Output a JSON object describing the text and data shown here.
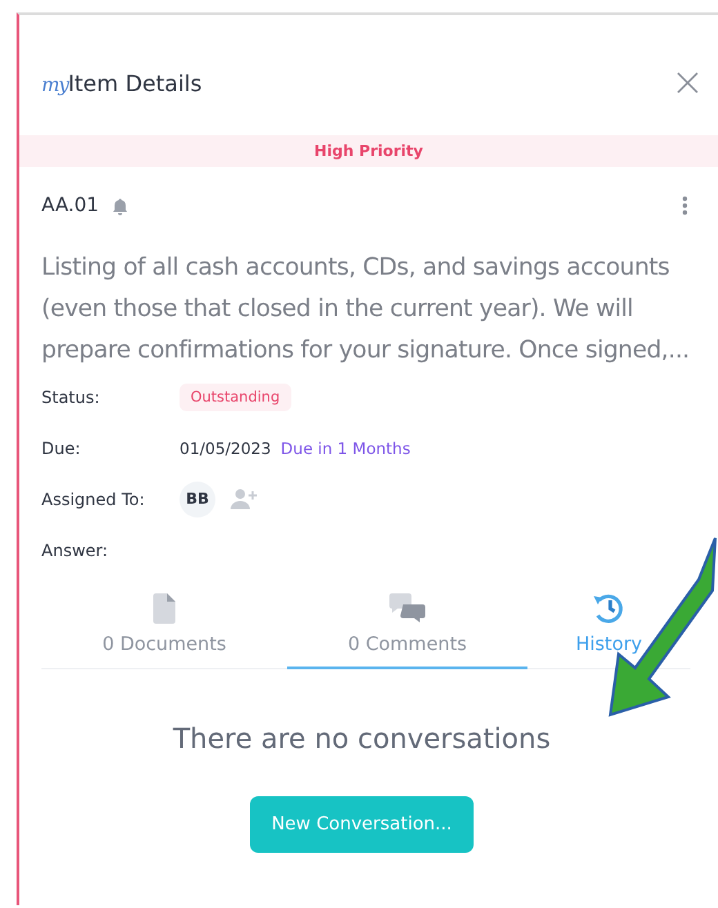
{
  "window": {
    "title_prefix": "my",
    "title": "Item Details"
  },
  "priority_banner": "High Priority",
  "item": {
    "code": "AA.01",
    "description": "Listing of all cash accounts, CDs, and savings accounts (even those that closed in the current year). We will prepare confirmations for your signature. Once signed,..."
  },
  "fields": [
    {
      "kind": "status",
      "label": "Status:",
      "value": "Outstanding"
    },
    {
      "kind": "due",
      "label": "Due:",
      "value": "01/05/2023",
      "note": "Due in 1 Months"
    },
    {
      "kind": "assignee",
      "label": "Assigned To:",
      "value": "BB"
    },
    {
      "kind": "plain",
      "label": "Answer:"
    }
  ],
  "tabs": [
    {
      "kind": "documents",
      "label": "0 Documents",
      "selected": false,
      "highlighted": false
    },
    {
      "kind": "comments",
      "label": "0 Comments",
      "selected": true,
      "highlighted": false
    },
    {
      "kind": "history",
      "label": "History",
      "selected": false,
      "highlighted": true
    }
  ],
  "empty_message": "There are no conversations",
  "primary_button": "New Conversation..."
}
